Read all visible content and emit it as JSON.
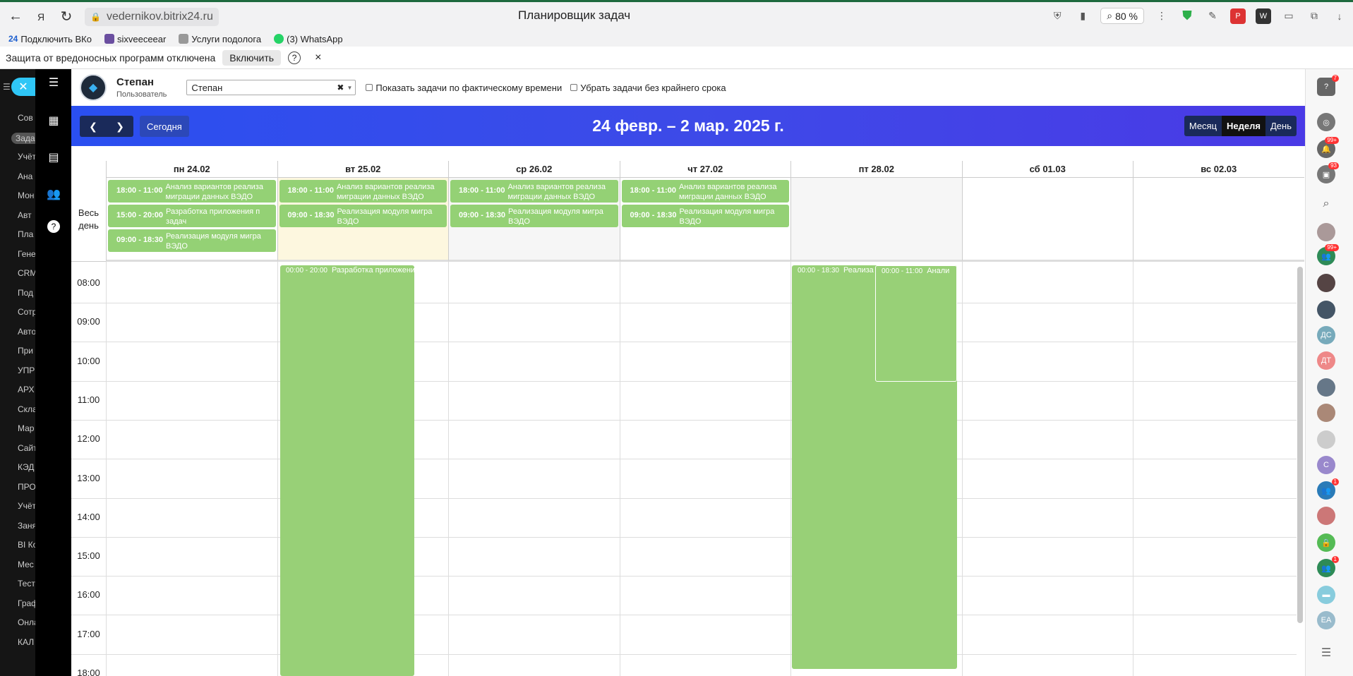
{
  "browser": {
    "url": "vedernikov.bitrix24.ru",
    "tab_title": "Планировщик задач",
    "zoom": "80 %"
  },
  "bookmarks": [
    "Подключить ВКо",
    "sixveeceear",
    "Услуги подолога",
    "(3) WhatsApp"
  ],
  "warning": {
    "text": "Защита от вредоносных программ отключена",
    "enable_label": "Включить",
    "help": "?",
    "close": "×"
  },
  "left_menu": [
    "Сов",
    "Зада",
    "Учёт",
    "Ана",
    "Мон",
    "Авт",
    "Пла",
    "Гене",
    "CRM",
    "Под",
    "Сотр",
    "Авто",
    "При",
    "УПР",
    "АРХ",
    "Скла",
    "Мар",
    "Сайт",
    "КЭД",
    "ПРО",
    "Учёт",
    "Заня",
    "BI Ко",
    "Мес",
    "Тест",
    "Граф",
    "Онла",
    "КАЛ"
  ],
  "user": {
    "name": "Степан",
    "role": "Пользователь",
    "selected": "Степан"
  },
  "filters": {
    "actual_time": "Показать задачи по фактическому времени",
    "no_deadline": "Убрать задачи без крайнего срока"
  },
  "calendar": {
    "range_title": "24 февр. – 2 мар. 2025 г.",
    "today_label": "Сегодня",
    "views": [
      "Месяц",
      "Неделя",
      "День"
    ],
    "active_view": "Неделя",
    "all_day_label": "Весь день",
    "days": [
      "пн 24.02",
      "вт 25.02",
      "ср 26.02",
      "чт 27.02",
      "пт 28.02",
      "сб 01.03",
      "вс 02.03"
    ],
    "hours": [
      "08:00",
      "09:00",
      "10:00",
      "11:00",
      "12:00",
      "13:00",
      "14:00",
      "15:00",
      "16:00",
      "17:00",
      "18:00"
    ],
    "allday_events": [
      [
        {
          "time": "18:00 - 11:00",
          "title": "Анализ вариантов реализа миграции данных ВЭДО"
        },
        {
          "time": "15:00 - 20:00",
          "title": "Разработка приложения п задач"
        },
        {
          "time": "09:00 - 18:30",
          "title": "Реализация модуля мигра ВЭДО"
        }
      ],
      [
        {
          "time": "18:00 - 11:00",
          "title": "Анализ вариантов реализа миграции данных ВЭДО"
        },
        {
          "time": "09:00 - 18:30",
          "title": "Реализация модуля мигра ВЭДО"
        }
      ],
      [
        {
          "time": "18:00 - 11:00",
          "title": "Анализ вариантов реализа миграции данных ВЭДО"
        },
        {
          "time": "09:00 - 18:30",
          "title": "Реализация модуля мигра ВЭДО"
        }
      ],
      [
        {
          "time": "18:00 - 11:00",
          "title": "Анализ вариантов реализа миграции данных ВЭДО"
        },
        {
          "time": "09:00 - 18:30",
          "title": "Реализация модуля мигра ВЭДО"
        }
      ],
      [],
      [],
      []
    ],
    "timed_events": {
      "tue": {
        "time": "00:00 - 20:00",
        "title": "Разработка приложения пл"
      },
      "fri_a": {
        "time": "00:00 - 18:30",
        "title": "Реализа"
      },
      "fri_b": {
        "time": "00:00 - 11:00",
        "title": "Анали"
      }
    }
  },
  "right_bar": {
    "help_badge": "7",
    "notif_badge": "99+",
    "chat_badge": "93",
    "group_badge": "99+",
    "initials_1": "ДС",
    "initials_2": "ДТ",
    "initials_3": "С",
    "initials_4": "ЕА",
    "badge_one": "1",
    "badge_two": "1"
  },
  "colors": {
    "event_green": "#94d175",
    "header_gradient_start": "#2a4ff0",
    "today_column": "#fdf7df"
  }
}
